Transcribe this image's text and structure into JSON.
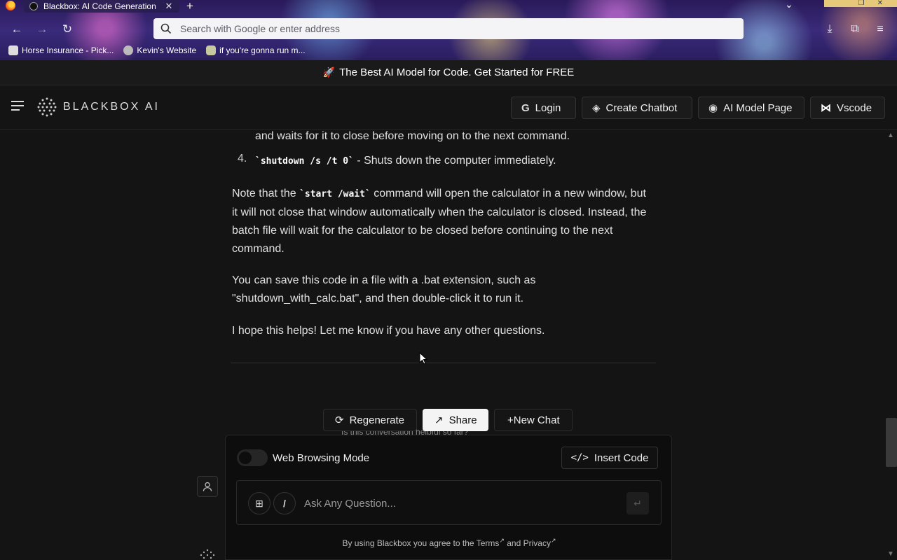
{
  "browser": {
    "tab_title": "Blackbox: AI Code Generation",
    "new_tab_icon": "plus-icon",
    "url_placeholder": "Search with Google or enter address",
    "bookmarks": [
      {
        "label": "Horse Insurance - Pick...",
        "icon": "bookmark-favicon"
      },
      {
        "label": "Kevin's Website",
        "icon": "globe-icon"
      },
      {
        "label": "if you're gonna run m...",
        "icon": "mask-favicon"
      }
    ]
  },
  "banner": {
    "icon": "rocket-icon",
    "text": "The Best AI Model for Code. Get Started for FREE"
  },
  "header": {
    "brand": "BLACKBOX AI",
    "buttons": {
      "login": "Login",
      "create_chatbot": "Create Chatbot",
      "ai_model_page": "AI Model Page",
      "vscode": "Vscode"
    }
  },
  "message": {
    "item3_tail": "and waits for it to close before moving on to the next command.",
    "item4_number": "4.",
    "item4_code": "`shutdown /s /t 0`",
    "item4_text": " - Shuts down the computer immediately.",
    "note_prefix": "Note that the ",
    "note_code": "`start /wait`",
    "note_suffix": " command will open the calculator in a new window, but it will not close that window automatically when the calculator is closed. Instead, the batch file will wait for the calculator to be closed before continuing to the next command.",
    "save_text": "You can save this code in a file with a .bat extension, such as \"shutdown_with_calc.bat\", and then double-click it to run it.",
    "closing_text": "I hope this helps! Let me know if you have any other questions."
  },
  "actions": {
    "regenerate": "Regenerate",
    "share": "Share",
    "new_chat": "+New Chat"
  },
  "feedback_text": "Is this conversation helpful so far?",
  "composer": {
    "web_browsing_label": "Web Browsing Mode",
    "web_browsing_enabled": false,
    "insert_code": "Insert Code",
    "slash_label": "/",
    "ask_placeholder": "Ask Any Question...",
    "terms_prefix": "By using Blackbox you agree to the ",
    "terms_link": "Terms",
    "terms_mid": " and ",
    "privacy_link": "Privacy"
  }
}
